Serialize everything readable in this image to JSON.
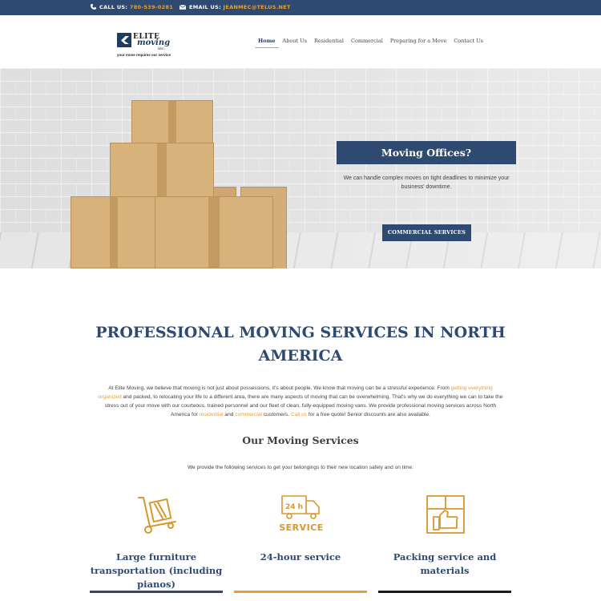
{
  "topbar": {
    "call_label": "CALL US:",
    "call_number": "780-539-0281",
    "email_label": "EMAIL US:",
    "email_address": "JEANMEC@TELUS.NET"
  },
  "logo": {
    "word1": "ELITE",
    "word2": "moving",
    "word3": "inc.",
    "tagline": "your move requires our service"
  },
  "nav": {
    "items": [
      "Home",
      "About Us",
      "Residential",
      "Commercial",
      "Preparing for a Move",
      "Contact Us"
    ],
    "active": "Home"
  },
  "hero": {
    "title": "Moving Offices?",
    "text": "We can handle complex moves on tight deadlines to minimize your business' downtime.",
    "button": "COMMERCIAL SERVICES"
  },
  "main": {
    "title": "PROFESSIONAL MOVING SERVICES IN NORTH AMERICA",
    "intro_1": "At Elite Moving, we believe that moving is not just about possessions, it's about people. We know that moving can be a stressful experience. From ",
    "intro_link_1": "getting everything organized",
    "intro_2": " and packed, to relocating your life to a different area, there are many aspects of moving that can be overwhelming. That's why we do everything we can to take the stress out of your move with our courteous, trained personnel and our fleet of clean, fully-equipped moving vans. We provide professional moving services across North America for ",
    "intro_link_2": "residential",
    "intro_3": " and ",
    "intro_link_3": "commercial",
    "intro_4": " customers. ",
    "intro_link_4": "Call us",
    "intro_5": " for a free quote! Senior discounts are also available.",
    "services_title": "Our Moving Services",
    "services_text": "We provide the following services to get your belongings to their new location safely and on time:"
  },
  "services": [
    {
      "title": "Large furniture transportation (including pianos)",
      "icon": "hand-truck-icon",
      "bar_color": "#2e4a70"
    },
    {
      "title": "24-hour service",
      "icon": "24h-truck-icon",
      "bar_color": "#e6a037",
      "icon_text_1": "24 h",
      "icon_text_2": "SERVICE"
    },
    {
      "title": "Packing service and materials",
      "icon": "hand-box-icon",
      "bar_color": "#1a1a1a"
    }
  ],
  "colors": {
    "navy": "#2e4a70",
    "accent": "#e6a037"
  }
}
